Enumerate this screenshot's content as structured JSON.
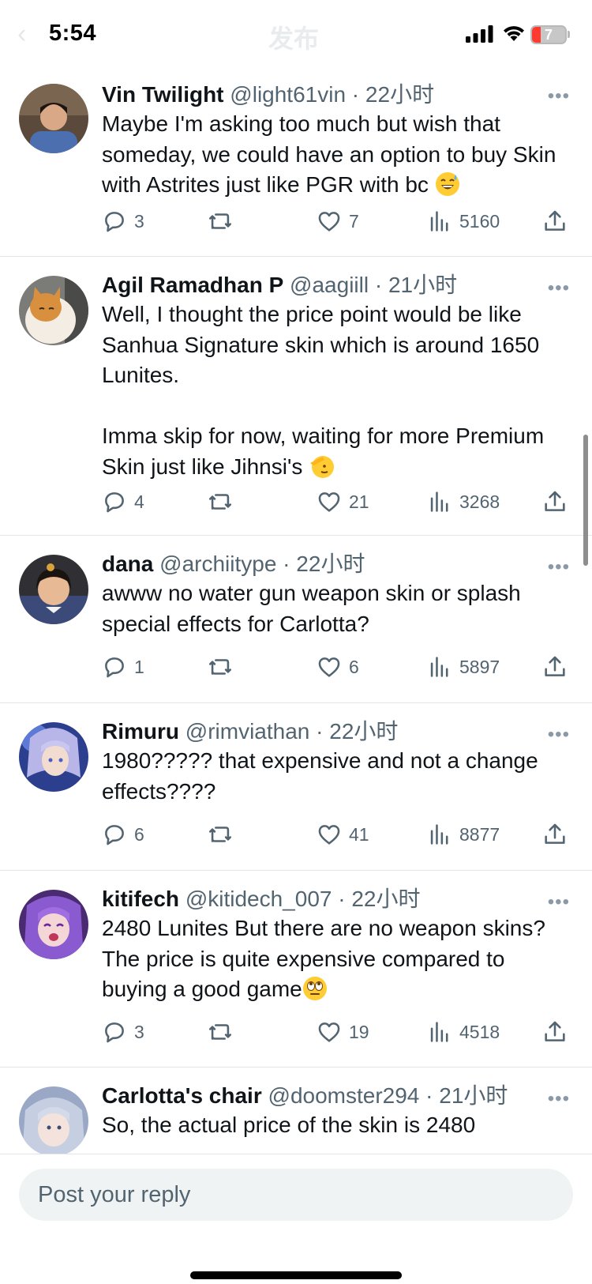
{
  "status_bar": {
    "time": "5:54",
    "faded_title": "发布",
    "battery": "7"
  },
  "tweets": [
    {
      "name": "Vin Twilight",
      "handle": "@light61vin",
      "sep": " · ",
      "time": "22小时",
      "text": "Maybe I'm asking too much but wish that someday, we could have an option to buy Skin with Astrites just like PGR with bc",
      "emoji": "sweat-smile-emoji",
      "replies": "3",
      "likes": "7",
      "views": "5160"
    },
    {
      "name": "Agil Ramadhan P",
      "handle": "@aagiill",
      "sep": " · ",
      "time": "21小时",
      "text": "Well, I thought the price point would be like Sanhua Signature skin which is around 1650 Lunites.\n\nImma skip for now, waiting for more Premium Skin just like Jihnsi's",
      "emoji": "saluting-face-emoji",
      "replies": "4",
      "likes": "21",
      "views": "3268"
    },
    {
      "name": "dana",
      "handle": "@archiitype",
      "sep": " · ",
      "time": "22小时",
      "text": "awww no water gun weapon skin or splash special effects for Carlotta?",
      "replies": "1",
      "likes": "6",
      "views": "5897"
    },
    {
      "name": "Rimuru",
      "handle": "@rimviathan",
      "sep": " · ",
      "time": "22小时",
      "text": "1980????? that expensive and not a change effects????",
      "replies": "6",
      "likes": "41",
      "views": "8877"
    },
    {
      "name": "kitifech",
      "handle": "@kitidech_007",
      "sep": " · ",
      "time": "22小时",
      "text": "2480 Lunites But there are no weapon skins?  The price is quite expensive compared to buying a good game",
      "emoji": "eye-roll-emoji",
      "replies": "3",
      "likes": "19",
      "views": "4518"
    },
    {
      "name": "Carlotta's chair",
      "handle": "@doomster294",
      "sep": " · ",
      "time": "21小时",
      "text": "So, the actual price of the skin is 2480"
    }
  ],
  "more_glyph": "•••",
  "reply_bar": {
    "placeholder": "Post your reply"
  },
  "colors": {
    "text": "#0f1419",
    "secondary": "#536471",
    "divider": "#e2e6ea",
    "input_bg": "#eff3f4"
  }
}
